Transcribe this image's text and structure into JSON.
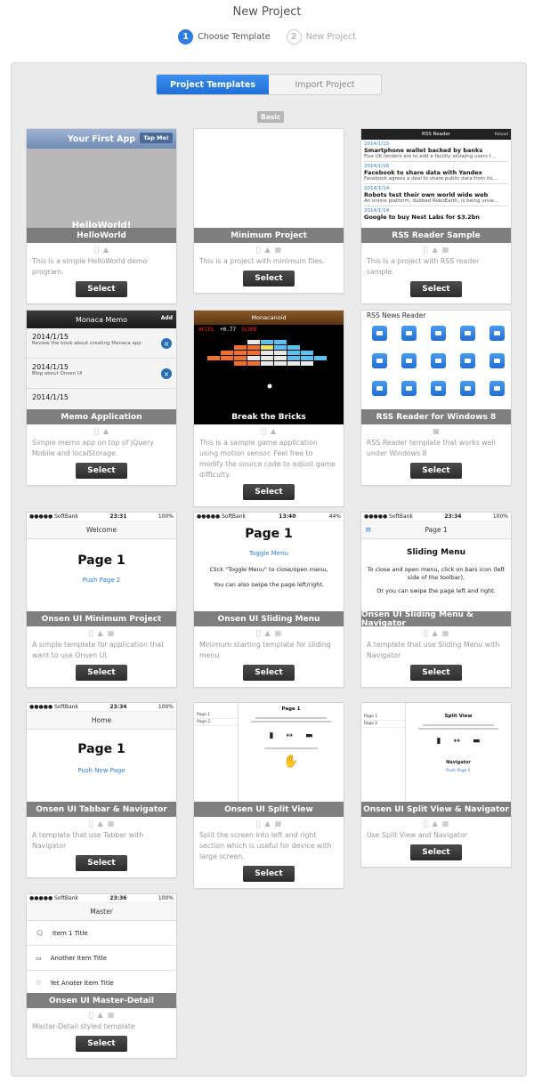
{
  "header": {
    "title": "New Project",
    "steps": [
      {
        "num": "1",
        "label": "Choose Template"
      },
      {
        "num": "2",
        "label": "New Project"
      }
    ]
  },
  "tabs": {
    "templates": "Project Templates",
    "import": "Import Project"
  },
  "section_badge": "Basic",
  "select_label": "Select",
  "colors": {
    "accent": "#2f7be6",
    "select_button": "#3a3a3a",
    "title_bar": "#787878"
  },
  "cards": [
    {
      "title": "HelloWorld",
      "desc": "This is a simple HelloWorld demo program.",
      "platforms": [
        "apple-icon",
        "android-icon"
      ]
    },
    {
      "title": "Minimum Project",
      "desc": "This is a project with minimum files.",
      "platforms": [
        "apple-icon",
        "android-icon",
        "windows-icon"
      ]
    },
    {
      "title": "RSS Reader Sample",
      "desc": "This is a project with RSS reader sample.",
      "platforms": [
        "apple-icon",
        "android-icon",
        "windows-icon"
      ]
    },
    {
      "title": "Memo Application",
      "desc": "Simple memo app on top of jQuery Mobile and localStorage.",
      "platforms": [
        "apple-icon",
        "android-icon"
      ]
    },
    {
      "title": "Break the Bricks",
      "desc": "This is a sample game application using motion sensor. Feel free to modify the source code to adjust game difficulty.",
      "platforms": [
        "apple-icon",
        "android-icon"
      ]
    },
    {
      "title": "RSS Reader for Windows 8",
      "desc": "RSS Reader template that works well under Windows 8",
      "platforms": [
        "windows-icon"
      ]
    },
    {
      "title": "Onsen UI Minimum Project",
      "desc": "A simple template for application that want to use Onsen UI.",
      "platforms": [
        "apple-icon",
        "android-icon",
        "windows-icon"
      ]
    },
    {
      "title": "Onsen UI Sliding Menu",
      "desc": "Minimum starting template for sliding menu",
      "platforms": [
        "apple-icon",
        "android-icon",
        "windows-icon"
      ]
    },
    {
      "title": "Onsen UI Sliding Menu & Navigator",
      "desc": "A template that use Sliding Menu with Navigator",
      "platforms": [
        "apple-icon",
        "android-icon",
        "windows-icon"
      ]
    },
    {
      "title": "Onsen UI Tabbar & Navigator",
      "desc": "A template that use Tabbar with Navigator",
      "platforms": [
        "apple-icon",
        "android-icon",
        "windows-icon"
      ]
    },
    {
      "title": "Onsen UI Split View",
      "desc": "Split the screen into left and right section which is useful for device with large screen.",
      "platforms": [
        "apple-icon",
        "android-icon",
        "windows-icon"
      ]
    },
    {
      "title": "Onsen UI Split View & Navigator",
      "desc": "Use Split View and Navigator",
      "platforms": [
        "apple-icon",
        "android-icon",
        "windows-icon"
      ]
    },
    {
      "title": "Onsen UI Master-Detail",
      "desc": "Master-Detail styled template",
      "platforms": [
        "apple-icon",
        "android-icon",
        "windows-icon"
      ]
    }
  ],
  "previews": {
    "hello": {
      "header": "Your First App",
      "button": "Tap Me!",
      "body": "HelloWorld!"
    },
    "rss": {
      "bar": "RSS Reader",
      "bar_btn": "Reload",
      "items": [
        {
          "date": "2014/1/15",
          "title": "Smartphone wallet backed by banks",
          "text": "Five UK lenders are to add a facility allowing users t..."
        },
        {
          "date": "2014/1/16",
          "title": "Facebook to share data with Yandex",
          "text": "Facebook agrees a deal to share public data from its..."
        },
        {
          "date": "2014/1/14",
          "title": "Robots test their own world wide web",
          "text": "An online platform, dubbed RoboEarth, is being unve..."
        },
        {
          "date": "2014/1/14",
          "title": "Google to buy Nest Labs for $3.2bn",
          "text": ""
        }
      ]
    },
    "memo": {
      "header": "Monaca Memo",
      "add": "Add",
      "items": [
        {
          "date": "2014/1/15",
          "text": "Review the book about creating Monaca app"
        },
        {
          "date": "2014/1/15",
          "text": "Blog about Onsen UI"
        },
        {
          "date": "2014/1/15",
          "text": ""
        }
      ]
    },
    "bricks": {
      "header": "Monacanoid",
      "accel_label": "ACCEL",
      "accel_value": "+0.77",
      "score_label": "SCORE"
    },
    "win8": {
      "header": "RSS News Reader"
    },
    "onsen_min": {
      "carrier": "●●●●● SoftBank",
      "time": "23:31",
      "battery": "100%",
      "bar": "Welcome",
      "big": "Page 1",
      "link": "Push Page 2"
    },
    "onsen_slide": {
      "carrier": "●●●●● SoftBank",
      "time": "13:40",
      "battery": "44%",
      "big": "Page 1",
      "link": "Toggle Menu",
      "text1": "Click \"Toggle Menu\" to close/open menu,",
      "text2": "You can also swipe the page left/right."
    },
    "onsen_slide_nav": {
      "carrier": "●●●●● SoftBank",
      "time": "23:34",
      "battery": "100%",
      "bar": "Page 1",
      "heading": "Sliding Menu",
      "text1": "To close and open menu, click on bars icon (left side of the toolbar),",
      "text2": "Or you can swipe the page left and right."
    },
    "onsen_tab": {
      "carrier": "●●●●● SoftBank",
      "time": "23:34",
      "battery": "100%",
      "bar": "Home",
      "big": "Page 1",
      "link": "Push New Page"
    },
    "split": {
      "page": "Page 1",
      "side1": "Page 1",
      "side2": "Page 2"
    },
    "split_nav": {
      "page": "Split View",
      "side1": "Page 1",
      "side2": "Page 2",
      "label": "Navigator",
      "link": "Push Page 2"
    },
    "master": {
      "carrier": "●●●●● SoftBank",
      "time": "23:36",
      "battery": "100%",
      "bar": "Master",
      "items": [
        "Item 1 Title",
        "Another Item Title",
        "Yet Anoter Item Title"
      ]
    }
  }
}
